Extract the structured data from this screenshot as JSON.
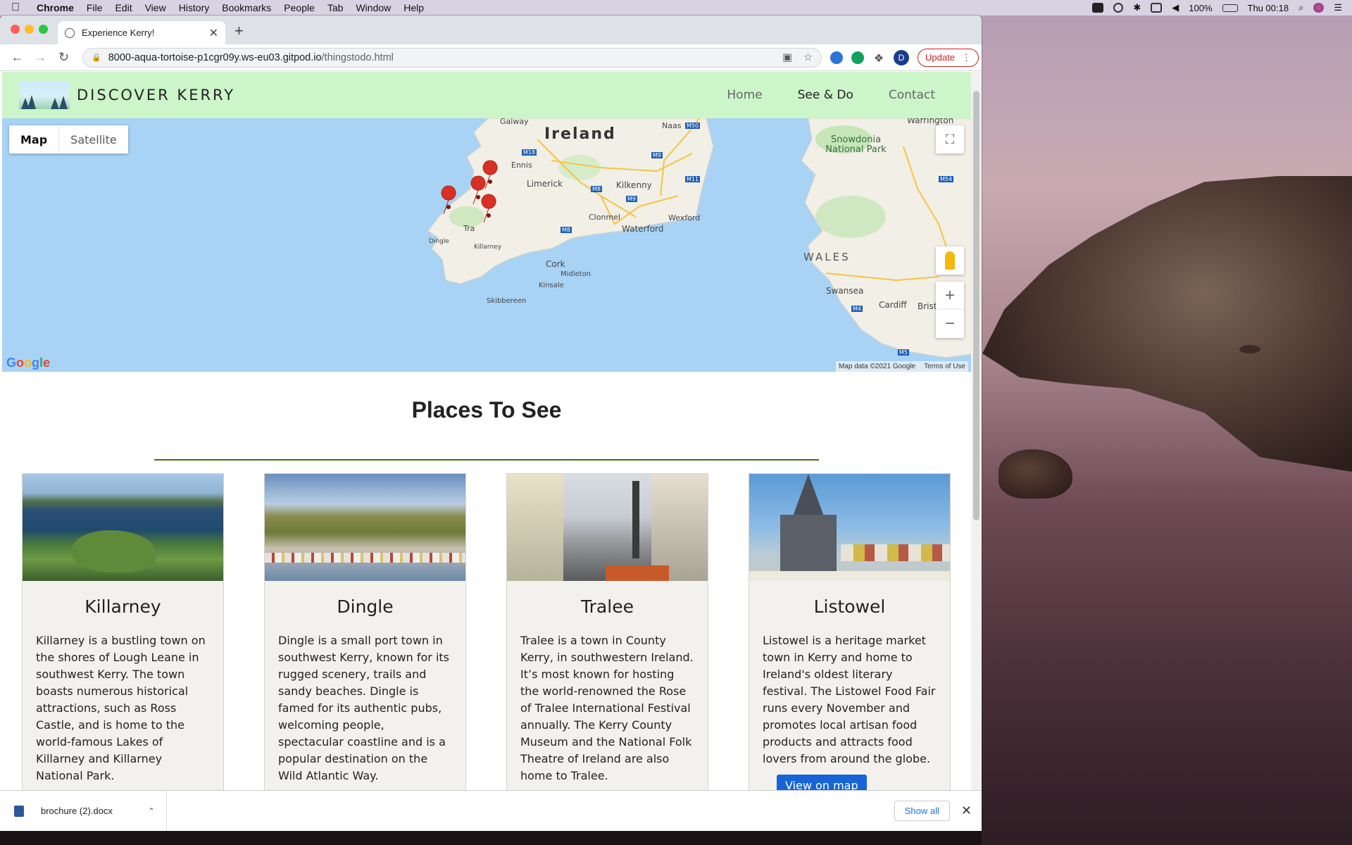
{
  "menubar": {
    "app_name": "Chrome",
    "items": [
      "File",
      "Edit",
      "View",
      "History",
      "Bookmarks",
      "People",
      "Tab",
      "Window",
      "Help"
    ],
    "battery": "100%",
    "clock": "Thu 00:18"
  },
  "browser": {
    "tab_title": "Experience Kerry!",
    "url_host": "8000-aqua-tortoise-p1cgr09y.ws-eu03.gitpod.io",
    "url_path": "/thingstodo.html",
    "profile_initial": "D",
    "update_label": "Update"
  },
  "site": {
    "brand": "DISCOVER KERRY",
    "nav": [
      "Home",
      "See & Do",
      "Contact"
    ],
    "active_nav": "See & Do"
  },
  "map": {
    "type_selected": "Map",
    "type_other": "Satellite",
    "attribution": "Map data ©2021 Google",
    "terms": "Terms of Use",
    "labels": {
      "ireland": "Ireland",
      "wales": "WALES",
      "snowdonia": "Snowdonia National Park",
      "galway": "Galway",
      "ennis": "Ennis",
      "limerick": "Limerick",
      "kilkenny": "Kilkenny",
      "clonmel": "Clonmel",
      "waterford": "Waterford",
      "wexford": "Wexford",
      "cork": "Cork",
      "midleton": "Midleton",
      "kinsale": "Kinsale",
      "skibbereen": "Skibbereen",
      "killarney": "Killarney",
      "dingle": "Dingle",
      "tralee": "Tra",
      "naas": "Naas",
      "warrington": "Warrington",
      "swansea": "Swansea",
      "cardiff": "Cardiff",
      "bristol": "Brist",
      "m50": "M50",
      "m18": "M18",
      "m9a": "M9",
      "m9b": "M9",
      "m8a": "M8",
      "m8b": "M8",
      "m11": "M11",
      "m54": "M54",
      "m4": "M4",
      "m5": "M5"
    }
  },
  "places": {
    "title": "Places To See",
    "button_label": "View on map",
    "cards": [
      {
        "name": "Killarney",
        "text": "Killarney is a bustling town on the shores of Lough Leane in southwest Kerry. The town boasts numerous historical attractions, such as Ross Castle, and is home to the world-famous Lakes of Killarney and Killarney National Park."
      },
      {
        "name": "Dingle",
        "text": "Dingle is a small port town in southwest Kerry, known for its rugged scenery, trails and sandy beaches. Dingle is famed for its authentic pubs, welcoming people, spectacular coastline and is a popular destination on the Wild Atlantic Way."
      },
      {
        "name": "Tralee",
        "text": "Tralee is a town in County Kerry, in southwestern Ireland. It’s most known for hosting the world-renowned the Rose of Tralee International Festival annually. The Kerry County Museum and the National Folk Theatre of Ireland are also home to Tralee."
      },
      {
        "name": "Listowel",
        "text": "Listowel is a heritage market town in Kerry and home to Ireland's oldest literary festival. The Listowel Food Fair runs every November and promotes local artisan food products and attracts food lovers from around the globe."
      }
    ]
  },
  "downloads": {
    "file_name": "brochure (2).docx",
    "show_all": "Show all"
  },
  "colors": {
    "nav_bg": "#ccf5c9",
    "button_blue": "#1565d8",
    "rule_green": "#4b6a16",
    "marker_red": "#d93025"
  }
}
